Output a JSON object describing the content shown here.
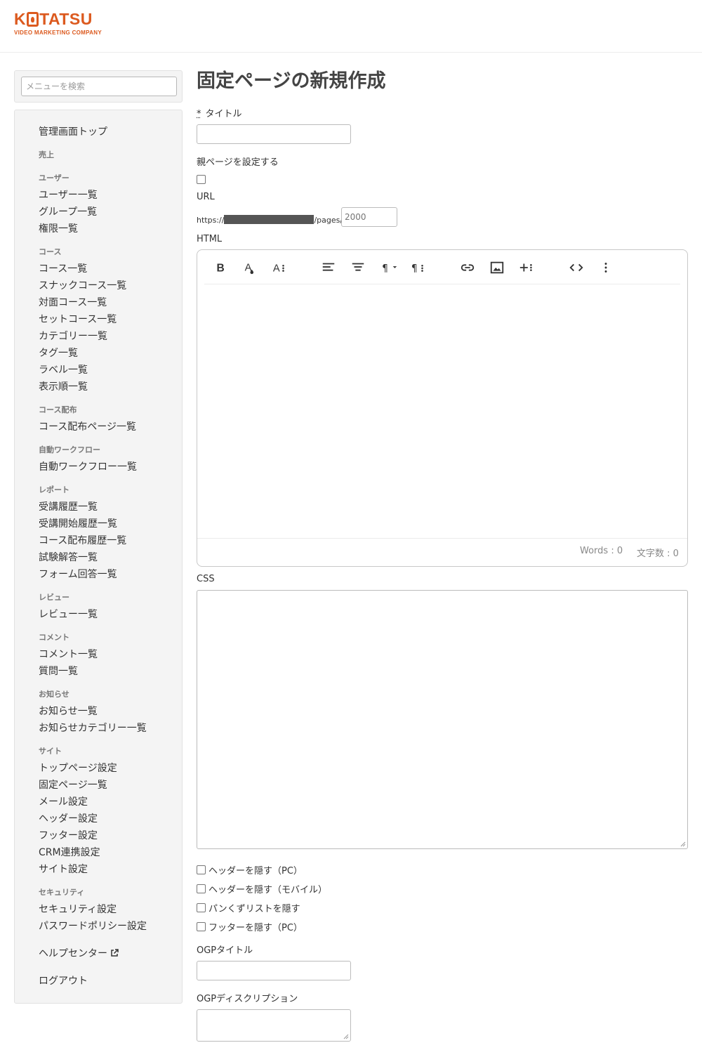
{
  "brand": {
    "logo_k": "K",
    "logo_rest": "TATSU",
    "tagline": "VIDEO MARKETING COMPANY",
    "color": "#dc5a1f"
  },
  "sidebar": {
    "search_placeholder": "メニューを検索",
    "menu": {
      "admin_top": "管理画面トップ",
      "sales_head": "売上",
      "users_head": "ユーザー",
      "users_list": "ユーザー一覧",
      "groups_list": "グループ一覧",
      "roles_list": "権限一覧",
      "courses_head": "コース",
      "courses_list": "コース一覧",
      "snack_courses_list": "スナックコース一覧",
      "inperson_courses_list": "対面コース一覧",
      "set_courses_list": "セットコース一覧",
      "categories_list": "カテゴリー一覧",
      "tags_list": "タグ一覧",
      "labels_list": "ラベル一覧",
      "display_order_list": "表示順一覧",
      "distribution_head": "コース配布",
      "distribution_pages_list": "コース配布ページ一覧",
      "workflow_head": "自動ワークフロー",
      "workflow_list": "自動ワークフロー一覧",
      "reports_head": "レポート",
      "attendance_history": "受講履歴一覧",
      "attendance_start_history": "受講開始履歴一覧",
      "distribution_history": "コース配布履歴一覧",
      "exam_answers": "試験解答一覧",
      "form_answers": "フォーム回答一覧",
      "reviews_head": "レビュー",
      "reviews_list": "レビュー一覧",
      "comments_head": "コメント",
      "comments_list": "コメント一覧",
      "questions_list": "質問一覧",
      "news_head": "お知らせ",
      "news_list": "お知らせ一覧",
      "news_categories_list": "お知らせカテゴリー一覧",
      "site_head": "サイト",
      "top_page_settings": "トップページ設定",
      "fixed_pages_list": "固定ページ一覧",
      "mail_settings": "メール設定",
      "header_settings": "ヘッダー設定",
      "footer_settings": "フッター設定",
      "crm_settings": "CRM連携設定",
      "site_settings": "サイト設定",
      "security_head": "セキュリティ",
      "security_settings": "セキュリティ設定",
      "password_policy_settings": "パスワードポリシー設定",
      "help_center": "ヘルプセンター",
      "logout": "ログアウト"
    }
  },
  "main": {
    "page_title": "固定ページの新規作成",
    "title_required_mark": "*",
    "title_label": "タイトル",
    "title_value": "",
    "parent_page_label": "親ページを設定する",
    "url_label": "URL",
    "url_prefix_start": "https://",
    "url_prefix_end": "/pages/",
    "url_slug_placeholder": "2000",
    "html_label": "HTML",
    "editor": {
      "toolbar_icons": [
        "bold-icon",
        "text-color-icon",
        "font-size-icon",
        "align-left-icon",
        "align-center-icon",
        "paragraph-format-icon",
        "paragraph-style-icon",
        "insert-link-icon",
        "insert-image-icon",
        "insert-more-icon",
        "code-view-icon",
        "more-vertical-icon"
      ],
      "words_label": "Words : 0",
      "chars_label": "文字数 : 0"
    },
    "css_label": "CSS",
    "options": {
      "hide_header_pc": "ヘッダーを隠す（PC）",
      "hide_header_mobile": "ヘッダーを隠す（モバイル）",
      "hide_breadcrumb": "パンくずリストを隠す",
      "hide_footer_pc": "フッターを隠す（PC）"
    },
    "ogp_title_label": "OGPタイトル",
    "ogp_description_label": "OGPディスクリプション"
  }
}
